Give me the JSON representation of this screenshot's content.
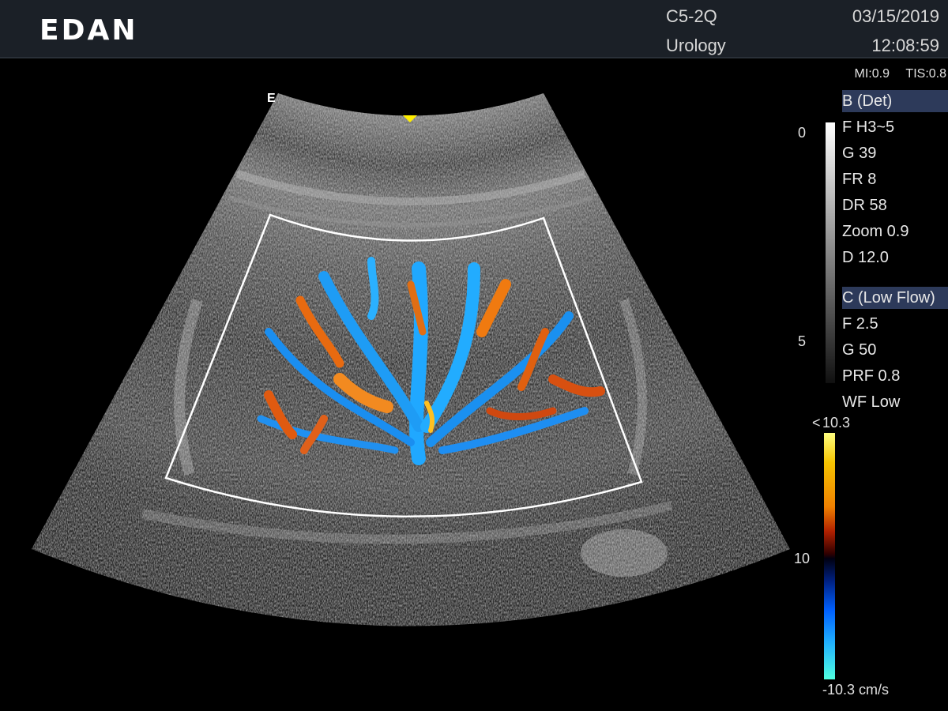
{
  "header": {
    "logo": "EDAN",
    "probe": "C5-2Q",
    "application": "Urology",
    "date": "03/15/2019",
    "time": "12:08:59"
  },
  "indices": {
    "mi": "MI:0.9",
    "tis": "TIS:0.8"
  },
  "image": {
    "orientation_mark": "E"
  },
  "b_mode": {
    "title": "B (Det)",
    "params": [
      "F H3~5",
      "G 39",
      "FR 8",
      "DR 58",
      "Zoom 0.9",
      "D 12.0"
    ]
  },
  "c_mode": {
    "title": "C (Low Flow)",
    "params": [
      "F 2.5",
      "G 50",
      "PRF 0.8",
      "WF Low"
    ]
  },
  "depth_scale": {
    "top": "0",
    "mid": "5",
    "lower": "10"
  },
  "color_scale": {
    "max": "10.3",
    "min": "-10.3 cm/s"
  },
  "colors": {
    "header_bg": "#1b2027",
    "section_bg": "#2d3a5a",
    "focus_marker": "#ffee00"
  }
}
